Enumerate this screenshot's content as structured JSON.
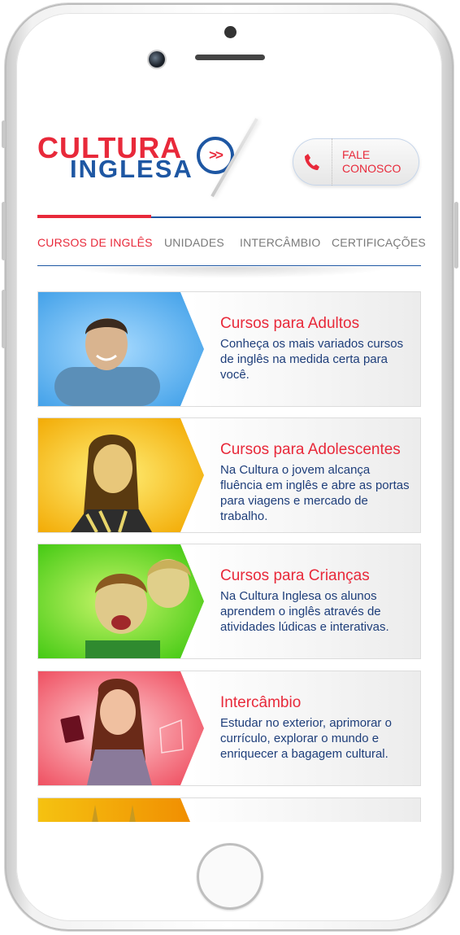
{
  "brand": {
    "line1": "CULTURA",
    "line2": "INGLESA",
    "mark": ">>",
    "red": "#e8293a",
    "blue": "#1e57a3"
  },
  "header": {
    "contact_label": "FALE CONOSCO",
    "contact_icon": "phone-icon"
  },
  "nav": {
    "items": [
      {
        "label": "CURSOS DE INGLÊS",
        "active": true
      },
      {
        "label": "UNIDADES",
        "active": false
      },
      {
        "label": "INTERCÂMBIO",
        "active": false
      },
      {
        "label": "CERTIFICAÇÕES",
        "active": false
      }
    ]
  },
  "cards": [
    {
      "title": "Cursos para Adultos",
      "desc": "Conheça os mais variados cursos de inglês na medida certa para você.",
      "color": "#5ab4f2"
    },
    {
      "title": "Cursos para Adolescentes",
      "desc": "Na Cultura o jovem alcança fluência em inglês e abre as portas para viagens e mercado de trabalho.",
      "color": "#f5c211"
    },
    {
      "title": "Cursos para Crianças",
      "desc": "Na Cultura Inglesa os alunos aprendem o inglês através de atividades lúdicas e interativas.",
      "color": "#69d316"
    },
    {
      "title": "Intercâmbio",
      "desc": "Estudar no exterior, aprimorar o currículo, explorar o mundo e enriquecer a bagagem cultural.",
      "color": "#f25a6a"
    },
    {
      "title": "",
      "desc": "",
      "color": "#f5c211"
    }
  ]
}
